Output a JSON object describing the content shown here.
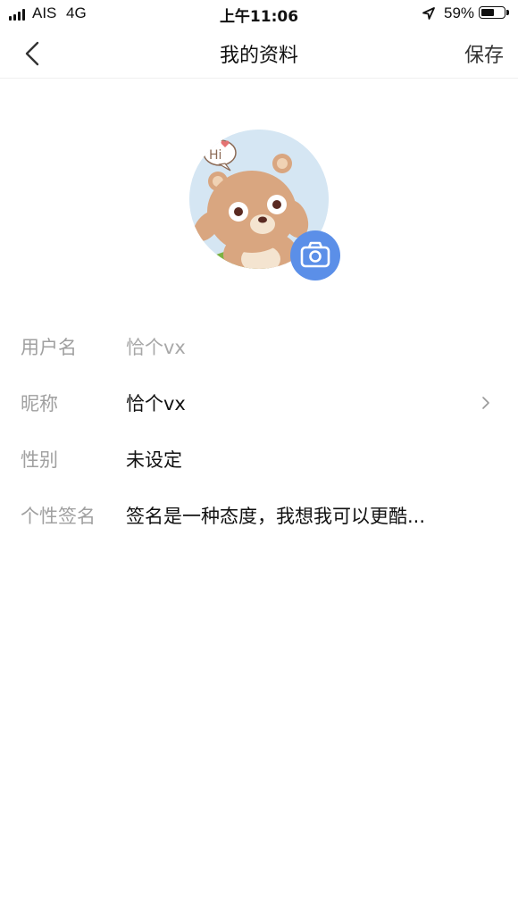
{
  "status_bar": {
    "carrier": "AIS",
    "network": "4G",
    "time": "上午11:06",
    "battery_percent": "59%",
    "battery_level": 0.59,
    "icons": [
      "signal-icon",
      "location-arrow-icon",
      "battery-icon"
    ]
  },
  "nav": {
    "title": "我的资料",
    "save_label": "保存",
    "back_icon": "chevron-left-icon"
  },
  "avatar": {
    "image": "bear-waving-hi",
    "bubble_text": "Hi",
    "camera_icon": "camera-icon",
    "camera_color": "#5b8fe8"
  },
  "form": {
    "username": {
      "label": "用户名",
      "value": "恰个vx"
    },
    "nickname": {
      "label": "昵称",
      "value": "恰个vx"
    },
    "gender": {
      "label": "性别",
      "value": "未设定"
    },
    "signature": {
      "label": "个性签名",
      "value": "签名是一种态度，我想我可以更酷..."
    }
  }
}
